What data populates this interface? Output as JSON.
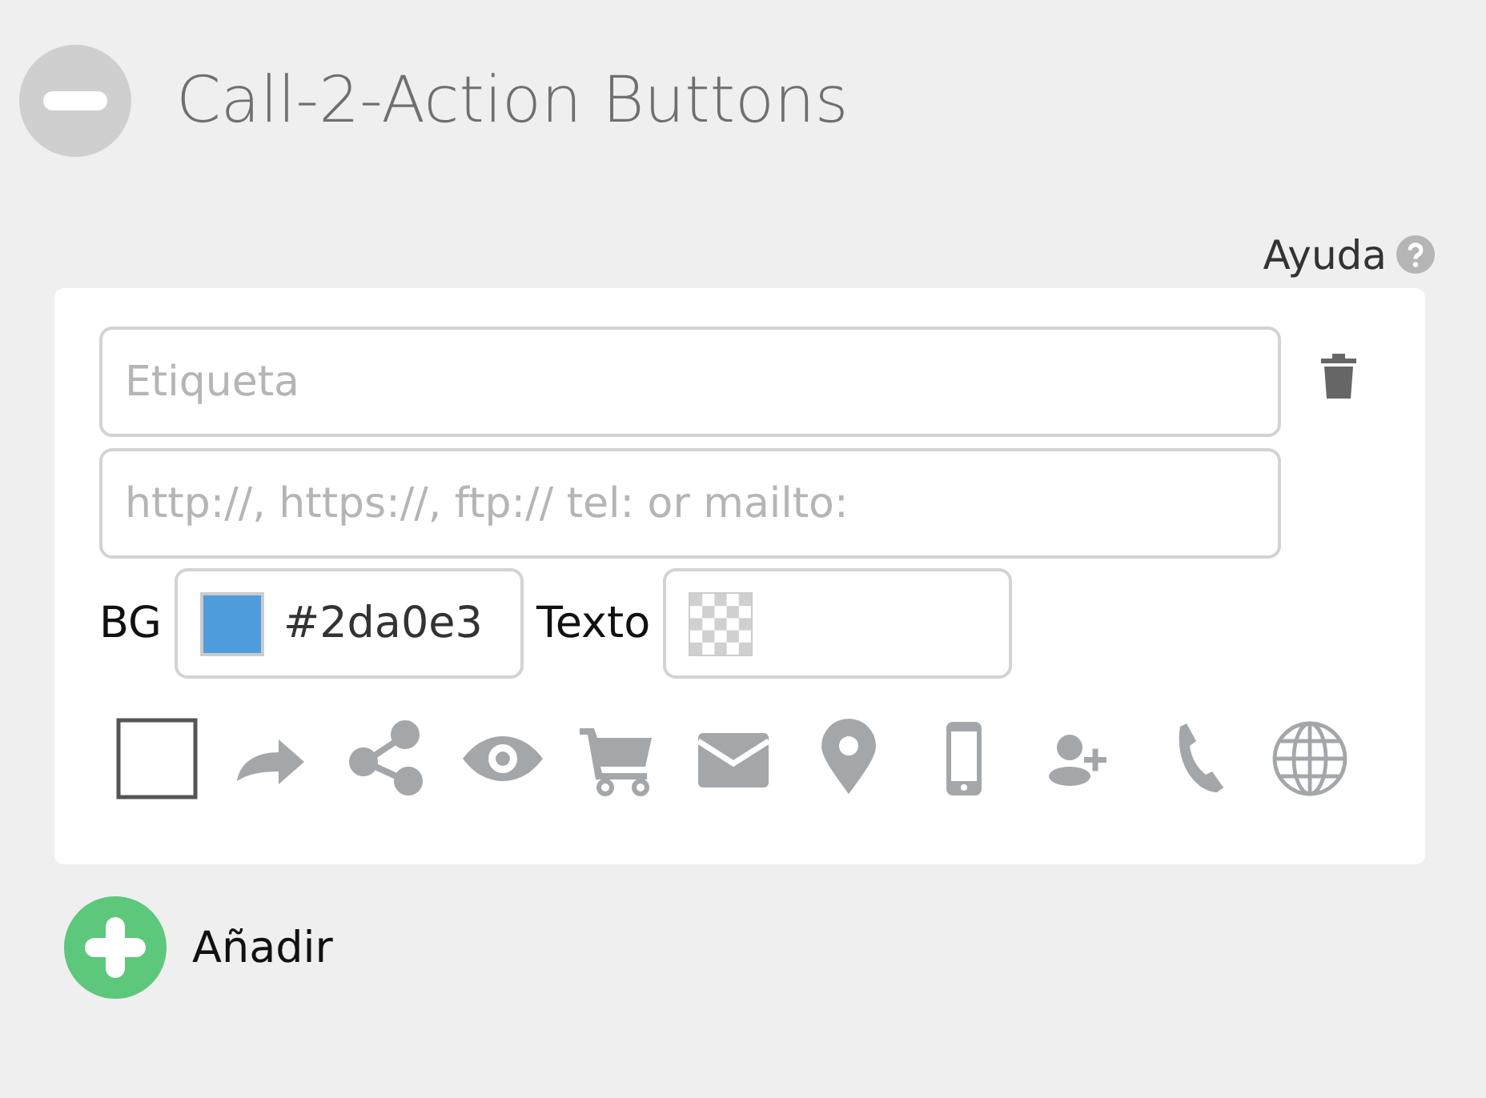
{
  "section": {
    "title": "Call-2-Action Buttons",
    "expanded": true
  },
  "help": {
    "label": "Ayuda"
  },
  "button": {
    "label_placeholder": "Etiqueta",
    "url_placeholder": "http://, https://, ftp:// tel: or mailto:",
    "bg": {
      "label": "BG",
      "value": "#2da0e3",
      "color": "#4f9ddc"
    },
    "text_color": {
      "label": "Texto",
      "transparent": true
    },
    "icons": [
      {
        "kind": "none",
        "selected": true
      },
      {
        "kind": "share-arrow",
        "selected": false
      },
      {
        "kind": "share",
        "selected": false
      },
      {
        "kind": "eye",
        "selected": false
      },
      {
        "kind": "cart",
        "selected": false
      },
      {
        "kind": "envelope",
        "selected": false
      },
      {
        "kind": "pin",
        "selected": false
      },
      {
        "kind": "phone",
        "selected": false
      },
      {
        "kind": "add-user",
        "selected": false
      },
      {
        "kind": "handset",
        "selected": false
      },
      {
        "kind": "globe",
        "selected": false
      }
    ]
  },
  "add": {
    "label": "Añadir"
  }
}
